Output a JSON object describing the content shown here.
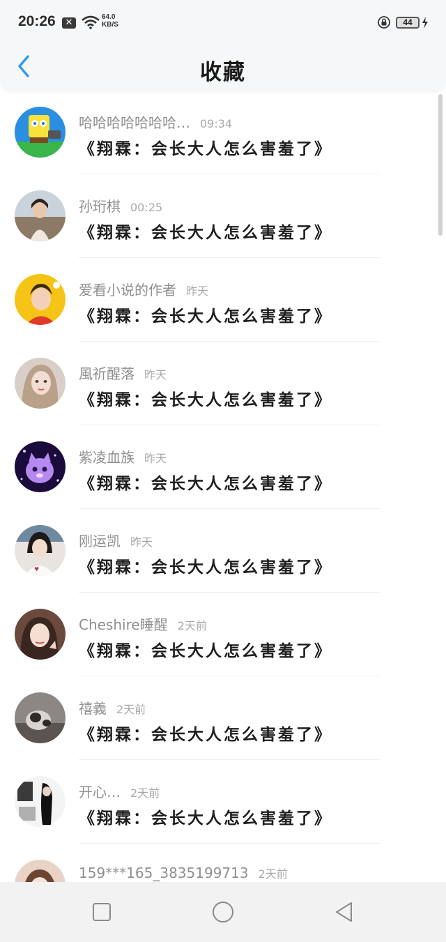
{
  "status_bar": {
    "time": "20:26",
    "net_speed_value": "64.0",
    "net_speed_unit": "KB/S",
    "battery": "44",
    "icons": [
      "notification-x-icon",
      "wifi-icon",
      "rotation-lock-icon",
      "battery-icon",
      "charging-bolt-icon"
    ]
  },
  "nav": {
    "title": "收藏",
    "back_icon": "chevron-left-icon",
    "accent": "#2f9bea"
  },
  "items": [
    {
      "name": "哈哈哈哈哈哈哈…",
      "time": "09:34",
      "text": "《翔霖：会长大人怎么害羞了》"
    },
    {
      "name": "孙珩棋",
      "time": "00:25",
      "text": "《翔霖：会长大人怎么害羞了》"
    },
    {
      "name": "爱看小说的作者",
      "time": "昨天",
      "text": "《翔霖：会长大人怎么害羞了》"
    },
    {
      "name": "風祈醒落",
      "time": "昨天",
      "text": "《翔霖：会长大人怎么害羞了》"
    },
    {
      "name": "紫凌血族",
      "time": "昨天",
      "text": "《翔霖：会长大人怎么害羞了》"
    },
    {
      "name": "刚运凯",
      "time": "昨天",
      "text": "《翔霖：会长大人怎么害羞了》"
    },
    {
      "name": "Cheshire睡醒",
      "time": "2天前",
      "text": "《翔霖：会长大人怎么害羞了》"
    },
    {
      "name": "禧義",
      "time": "2天前",
      "text": "《翔霖：会长大人怎么害羞了》"
    },
    {
      "name": "开心…",
      "time": "2天前",
      "text": "《翔霖：会长大人怎么害羞了》"
    },
    {
      "name": "159***165_3835199713",
      "time": "2天前",
      "text": ""
    }
  ],
  "system_nav": {
    "buttons": [
      "recents-square-icon",
      "home-circle-icon",
      "back-triangle-icon"
    ]
  }
}
